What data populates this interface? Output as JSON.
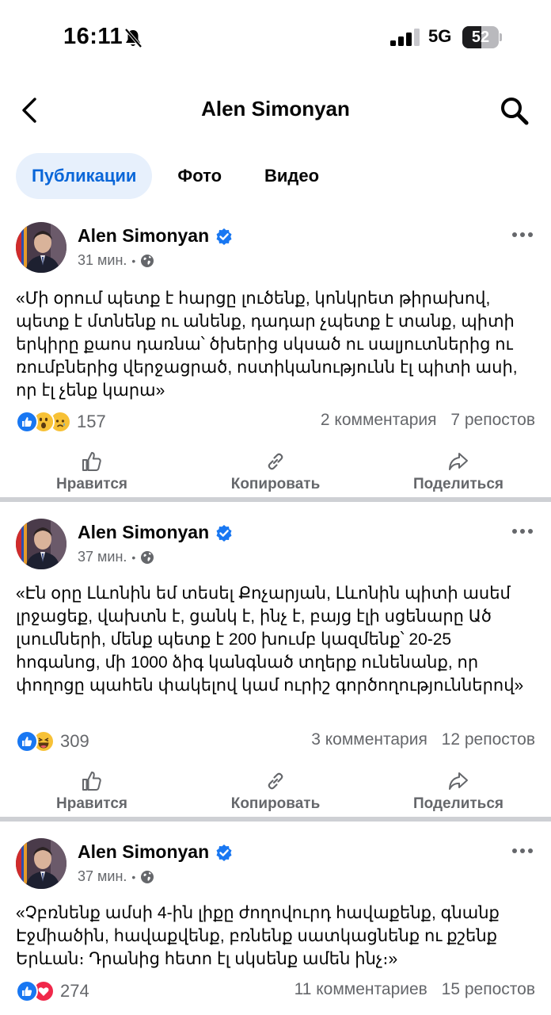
{
  "status_bar": {
    "time": "16:11",
    "network": "5G",
    "battery_level": "52",
    "battery_fraction": 0.52
  },
  "header": {
    "title": "Alen Simonyan",
    "back_icon": "chevron-left-icon",
    "search_icon": "search-icon"
  },
  "tabs": [
    {
      "label": "Публикации",
      "active": true
    },
    {
      "label": "Фото",
      "active": false
    },
    {
      "label": "Видео",
      "active": false
    }
  ],
  "actions": {
    "like": "Нравится",
    "copy": "Копировать",
    "share": "Поделиться"
  },
  "colors": {
    "accent": "#0a66d8",
    "verified": "#1877f2",
    "secondary_text": "#65676b",
    "divider": "#ced0d4"
  },
  "posts": [
    {
      "author": "Alen Simonyan",
      "time": "31 мин.",
      "text": "«Մի օրում պետք է հարցը լուծենք, կոնկրետ թիրախով, պետք է մտնենք ու անենք, դադար չպետք է տանք, պիտի երկիրը քաոս դառնա՝ ծխերից սկսած ու սալյուտներից ու ռումբներից վերջացրած, ոստիկանությունն էլ պիտի ասի, որ էլ չենք կարա»",
      "reactions": [
        "like",
        "wow",
        "sad"
      ],
      "reaction_count": "157",
      "comments": "2 комментария",
      "reposts": "7 репостов"
    },
    {
      "author": "Alen Simonyan",
      "time": "37 мин.",
      "text": "«Էն օրը Լևոնին եմ տեսել Քոչարյան, Լևոնին պիտի ասեմ լրջացեք, վախտն է, ցանկ է, ինչ է, բայց էլի սցենարը Ած լսումների, մենք պետք է 200 խումբ կազմենք՝ 20-25 հոգանոց, մի 1000 ձիգ կանգնած տղերք ունենանք, որ փողոցը պահեն փակելով կամ ուրիշ գործողություններով»",
      "reactions": [
        "like",
        "haha"
      ],
      "reaction_count": "309",
      "comments": "3 комментария",
      "reposts": "12 репостов"
    },
    {
      "author": "Alen Simonyan",
      "time": "37 мин.",
      "text": "«Չբռնենք ամսի 4-ին լիքը ժողովուրդ հավաքենք, գնանք Էջմիածին, հավաքվենք, բռնենք սատկացնենք ու քշենք Երևան։ Դրանից հետո էլ սկսենք ամեն ինչ։»",
      "reactions": [
        "like",
        "love"
      ],
      "reaction_count": "274",
      "comments": "11 комментариев",
      "reposts": "15 репостов"
    }
  ]
}
